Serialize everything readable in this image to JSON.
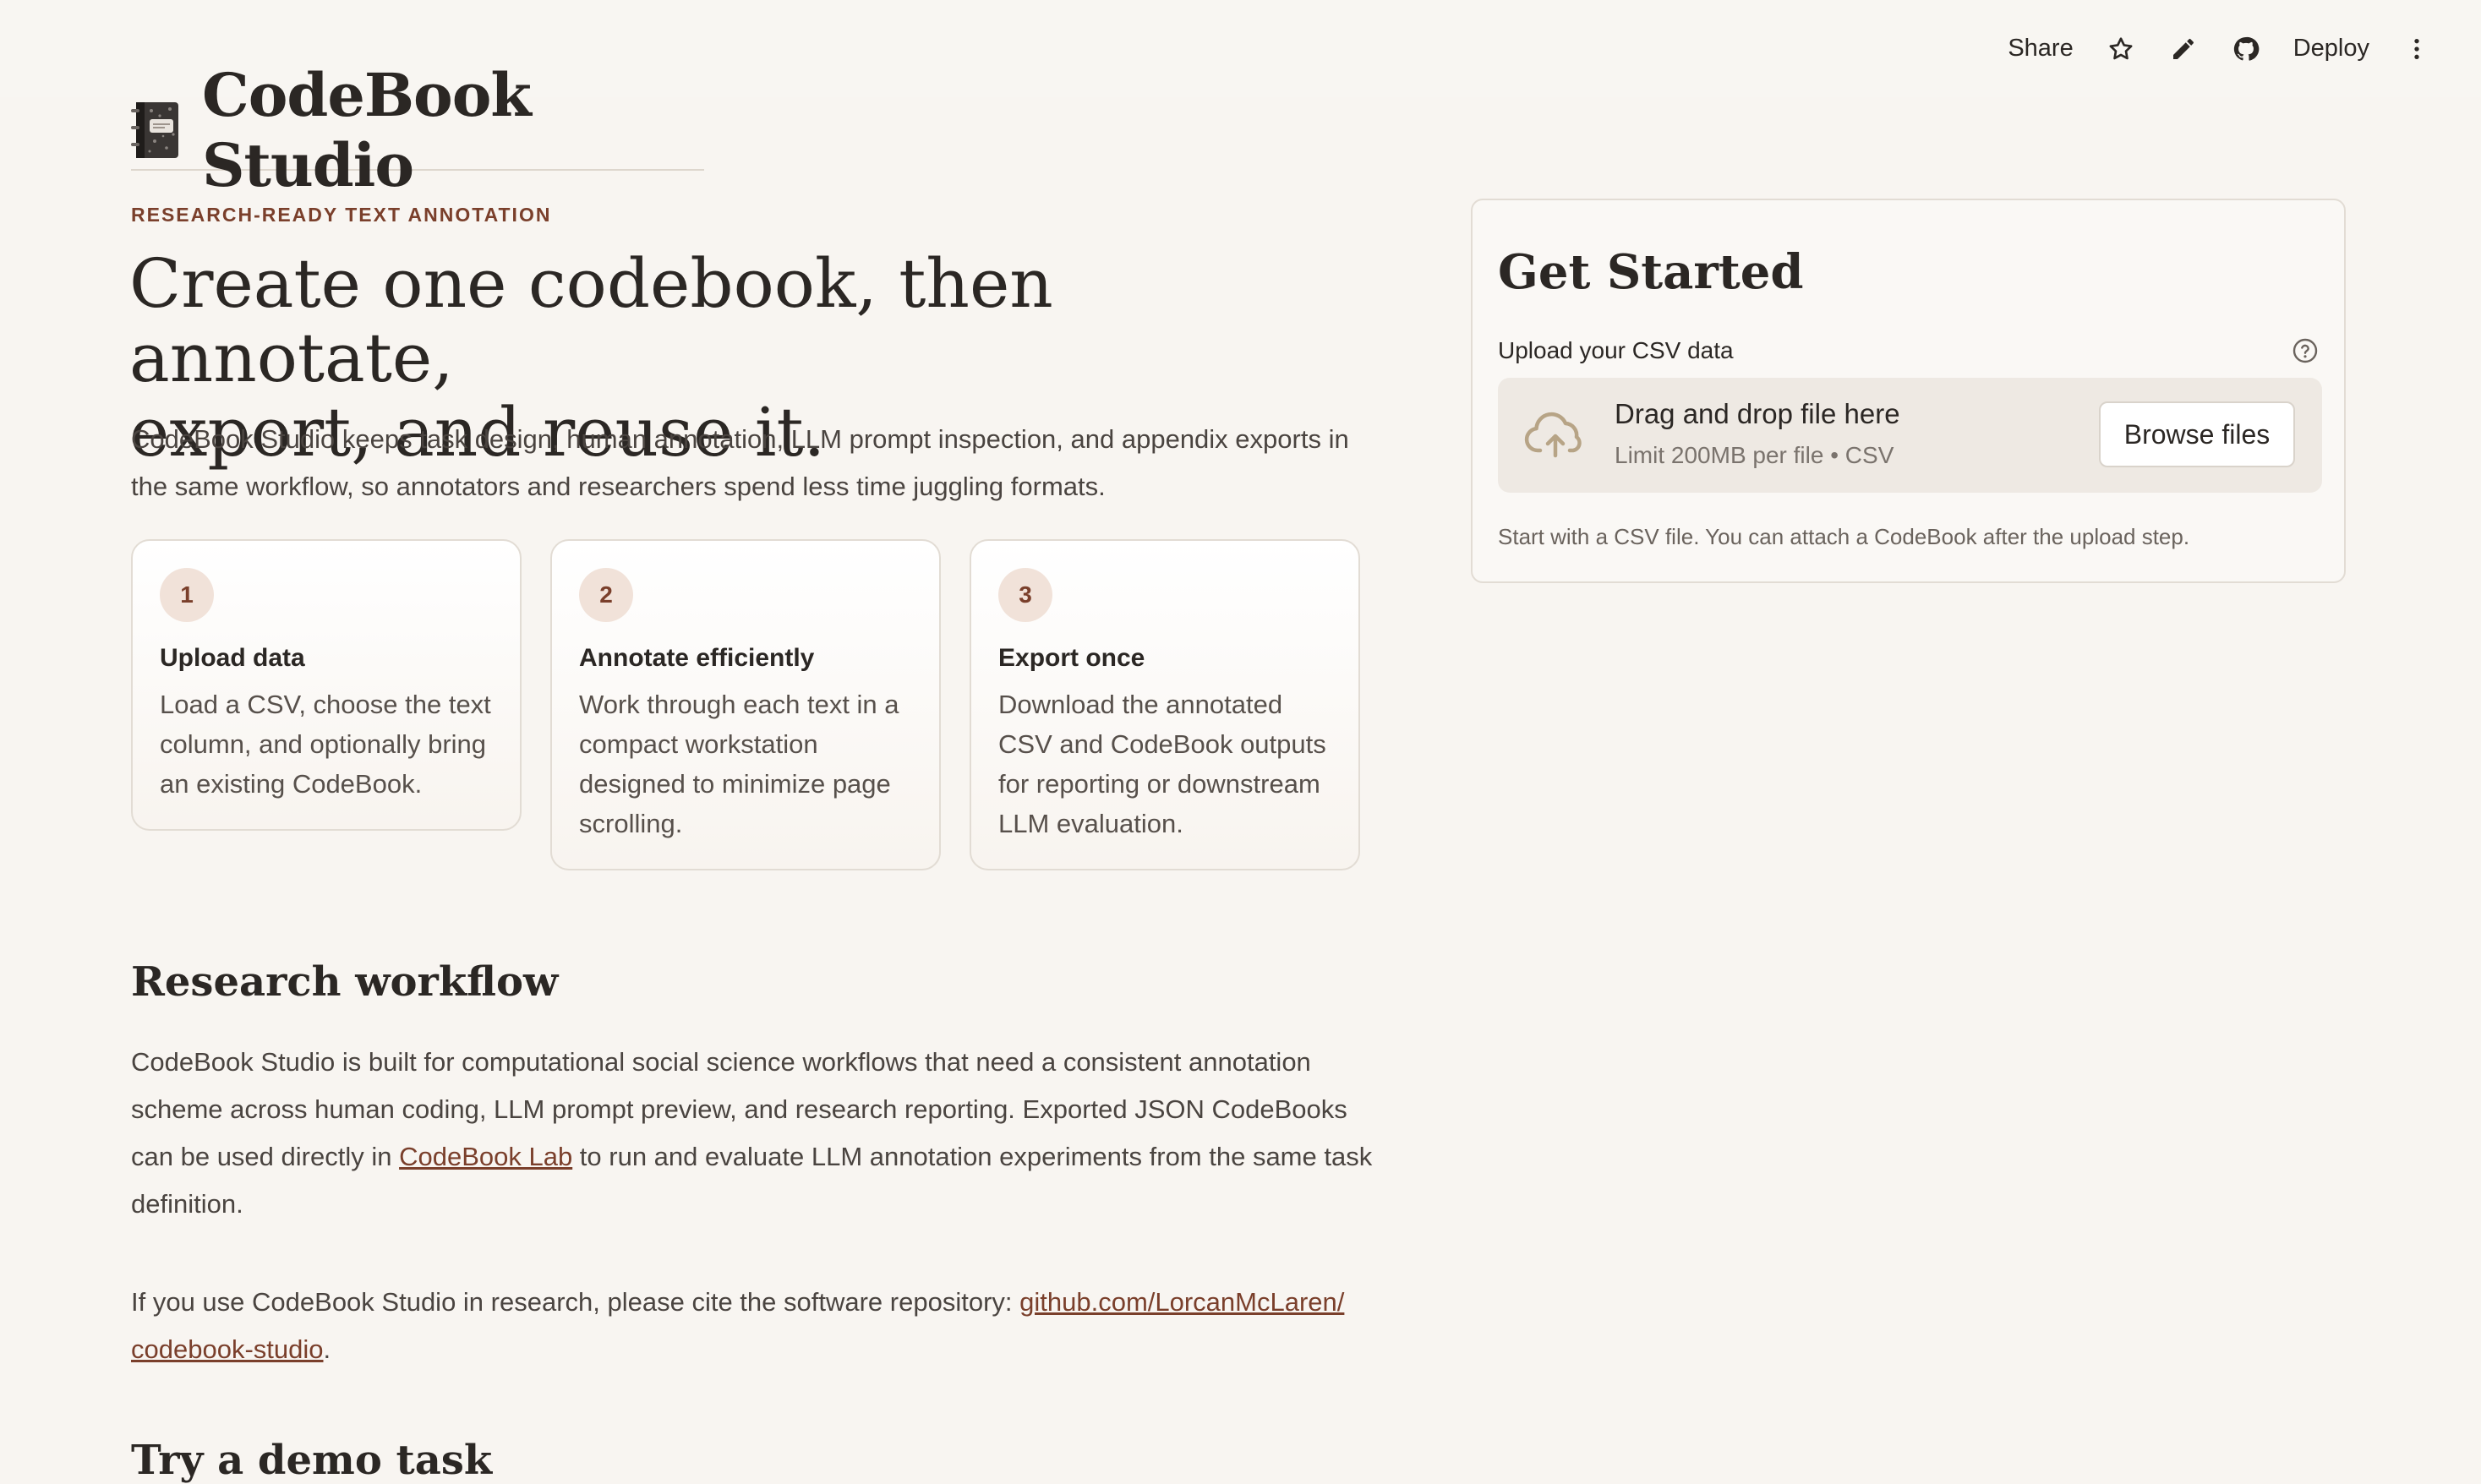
{
  "toolbar": {
    "share_label": "Share",
    "deploy_label": "Deploy",
    "icons": [
      "star-icon",
      "pencil-icon",
      "github-icon",
      "more-vertical-icon"
    ]
  },
  "app": {
    "title": "CodeBook Studio",
    "title_icon": "notebook-icon"
  },
  "hero": {
    "eyebrow": "RESEARCH-READY TEXT ANNOTATION",
    "headline_line1": "Create one codebook, then annotate,",
    "headline_line2": "export, and reuse it.",
    "intro": "CodeBook Studio keeps task design, human annotation, LLM prompt inspection, and appendix exports in the same workflow, so annotators and researchers spend less time juggling formats."
  },
  "steps": [
    {
      "number": "1",
      "title": "Upload data",
      "description": "Load a CSV, choose the text column, and optionally bring an existing CodeBook."
    },
    {
      "number": "2",
      "title": "Annotate efficiently",
      "description": "Work through each text in a compact workstation designed to minimize page scrolling."
    },
    {
      "number": "3",
      "title": "Export once",
      "description": "Download the annotated CSV and CodeBook outputs for reporting or downstream LLM evaluation."
    }
  ],
  "workflow": {
    "heading": "Research workflow",
    "para_before_link": "CodeBook Studio is built for computational social science workflows that need a consistent annotation scheme across human coding, LLM prompt preview, and research reporting. Exported JSON CodeBooks can be used directly in ",
    "link_label": "CodeBook Lab",
    "para_after_link": " to run and evaluate LLM annotation experiments from the same task definition.",
    "cite_before_link": "If you use CodeBook Studio in research, please cite the software repository: ",
    "cite_link_line1": "github.com/LorcanMcLaren/",
    "cite_link_line2": "codebook-studio",
    "cite_after_link": "."
  },
  "demo": {
    "heading": "Try a demo task"
  },
  "get_started": {
    "heading": "Get Started",
    "upload_label": "Upload your CSV data",
    "dropzone_title": "Drag and drop file here",
    "dropzone_limit": "Limit 200MB per file • CSV",
    "browse_label": "Browse files",
    "note": "Start with a CSV file. You can attach a CodeBook after the upload step."
  }
}
